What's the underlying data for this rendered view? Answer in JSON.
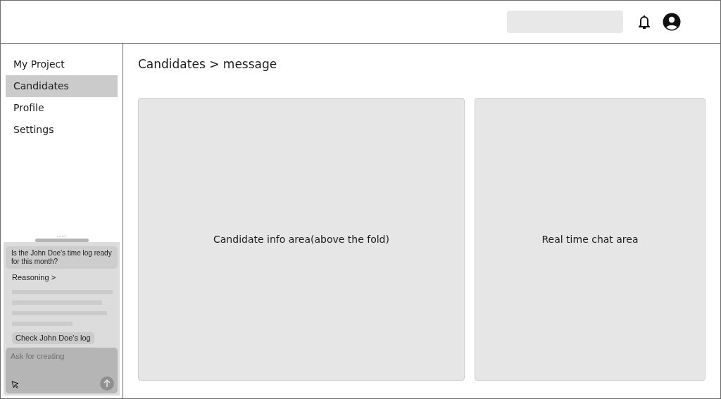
{
  "header": {
    "search": {
      "kind": "empty-field"
    }
  },
  "sidebar": {
    "items": [
      {
        "label": "My Project",
        "selected": false
      },
      {
        "label": "Candidates",
        "selected": true
      },
      {
        "label": "Profile",
        "selected": false
      },
      {
        "label": "Settings",
        "selected": false
      }
    ]
  },
  "assistant": {
    "handle_dots": "......",
    "question": "Is the John Doe’s time log ready for this month?",
    "reasoning": "Reasoning >",
    "action": "Check John Doe's log",
    "input": {
      "placeholder": "Ask for creating"
    }
  },
  "breadcrumb": "Candidates > message",
  "panels": [
    {
      "label": "Candidate info area(above the fold)"
    },
    {
      "label": "Real time chat area"
    }
  ]
}
